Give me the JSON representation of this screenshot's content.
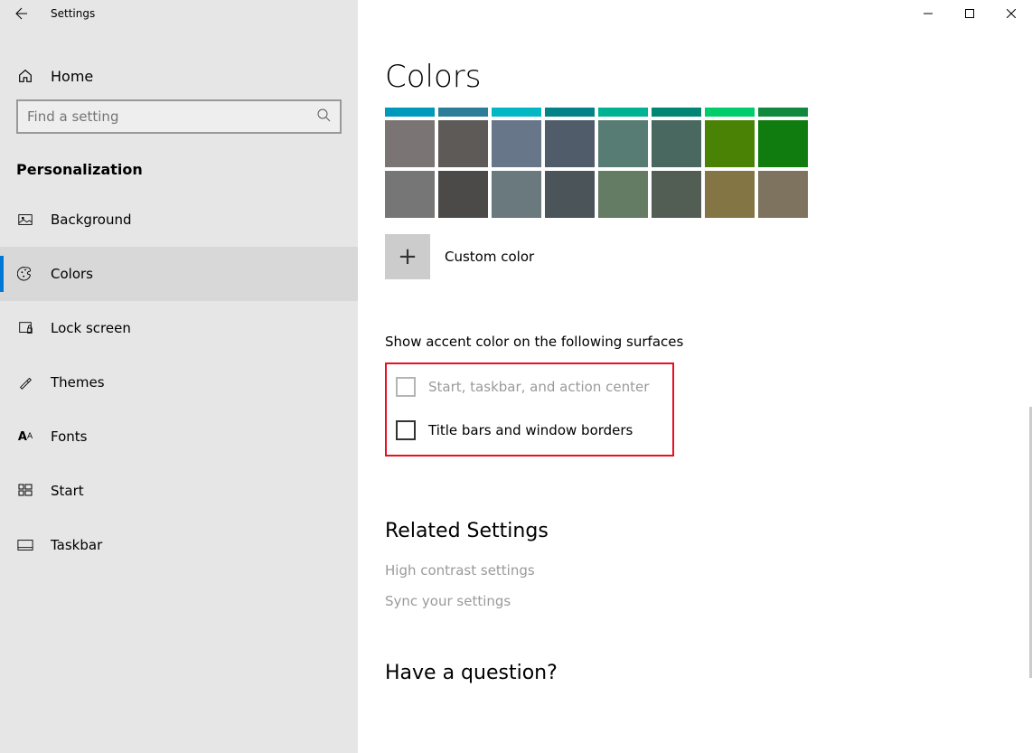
{
  "titlebar": {
    "app_title": "Settings"
  },
  "sidebar": {
    "home_label": "Home",
    "search_placeholder": "Find a setting",
    "section": "Personalization",
    "items": [
      {
        "id": "background",
        "label": "Background"
      },
      {
        "id": "colors",
        "label": "Colors",
        "selected": true
      },
      {
        "id": "lock-screen",
        "label": "Lock screen"
      },
      {
        "id": "themes",
        "label": "Themes"
      },
      {
        "id": "fonts",
        "label": "Fonts"
      },
      {
        "id": "start",
        "label": "Start"
      },
      {
        "id": "taskbar",
        "label": "Taskbar"
      }
    ]
  },
  "content": {
    "page_title": "Colors",
    "swatch_rows": {
      "row0_partial": [
        "#0099bc",
        "#2d7d9a",
        "#00b7c3",
        "#038387",
        "#00b294",
        "#018574",
        "#00cc6a",
        "#10893e"
      ],
      "row1": [
        "#7a7574",
        "#5d5a58",
        "#68768a",
        "#515c6b",
        "#567c73",
        "#486860",
        "#498205",
        "#107c10"
      ],
      "row2": [
        "#767676",
        "#4c4a48",
        "#69797e",
        "#4a5459",
        "#647c64",
        "#525e54",
        "#847545",
        "#7e735f"
      ]
    },
    "custom_color_label": "Custom color",
    "accent_surfaces_heading": "Show accent color on the following surfaces",
    "checkbox1_label": "Start, taskbar, and action center",
    "checkbox2_label": "Title bars and window borders",
    "related_heading": "Related Settings",
    "related_links": [
      "High contrast settings",
      "Sync your settings"
    ],
    "question_heading": "Have a question?"
  }
}
